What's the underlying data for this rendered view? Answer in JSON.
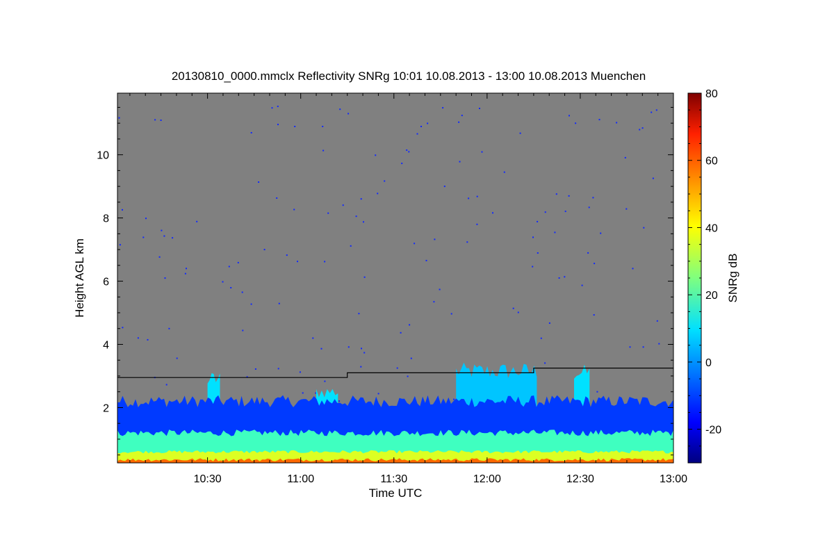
{
  "chart_data": {
    "type": "heatmap",
    "title": "20130810_0000.mmclx Reflectivity SNRg   10:01 10.08.2013 - 13:00 10.08.2013 Muenchen",
    "xlabel": "Time UTC",
    "ylabel": "Height AGL km",
    "colorbar_label": "SNRg dB",
    "x_range_minutes_utc": [
      601,
      780
    ],
    "y_range_km": [
      0.25,
      11.95
    ],
    "color_range_db": [
      -30,
      80
    ],
    "x_ticks": [
      {
        "label": "10:30",
        "minute": 630
      },
      {
        "label": "11:00",
        "minute": 660
      },
      {
        "label": "11:30",
        "minute": 690
      },
      {
        "label": "12:00",
        "minute": 720
      },
      {
        "label": "12:30",
        "minute": 750
      },
      {
        "label": "13:00",
        "minute": 780
      }
    ],
    "y_ticks": [
      {
        "label": "2",
        "km": 2
      },
      {
        "label": "4",
        "km": 4
      },
      {
        "label": "6",
        "km": 6
      },
      {
        "label": "8",
        "km": 8
      },
      {
        "label": "10",
        "km": 10
      }
    ],
    "colorbar_ticks": [
      {
        "label": "-20",
        "db": -20
      },
      {
        "label": "0",
        "db": 0
      },
      {
        "label": "20",
        "db": 20
      },
      {
        "label": "40",
        "db": 40
      },
      {
        "label": "60",
        "db": 60
      },
      {
        "label": "80",
        "db": 80
      }
    ],
    "background_color": "#808080",
    "detection_limit_line_km": [
      {
        "minute": 601,
        "km": 2.95
      },
      {
        "minute": 675,
        "km": 2.95
      },
      {
        "minute": 675,
        "km": 3.1
      },
      {
        "minute": 735,
        "km": 3.1
      },
      {
        "minute": 735,
        "km": 3.25
      },
      {
        "minute": 780,
        "km": 3.25
      }
    ],
    "cloud_features": [
      {
        "minute_start": 601,
        "minute_end": 780,
        "km_top": 0.35,
        "snr_db": 55
      },
      {
        "minute_start": 601,
        "minute_end": 780,
        "km_top": 0.6,
        "snr_db": 35
      },
      {
        "minute_start": 601,
        "minute_end": 780,
        "km_top": 1.2,
        "snr_db": 18
      },
      {
        "minute_start": 601,
        "minute_end": 780,
        "km_top": 2.2,
        "snr_db": -10
      },
      {
        "minute_start": 630,
        "minute_end": 634,
        "km_top": 2.9,
        "snr_db": 8
      },
      {
        "minute_start": 665,
        "minute_end": 672,
        "km_top": 2.5,
        "snr_db": 8
      },
      {
        "minute_start": 710,
        "minute_end": 736,
        "km_top": 3.15,
        "snr_db": 5
      },
      {
        "minute_start": 748,
        "minute_end": 753,
        "km_top": 3.1,
        "snr_db": 8
      }
    ]
  }
}
